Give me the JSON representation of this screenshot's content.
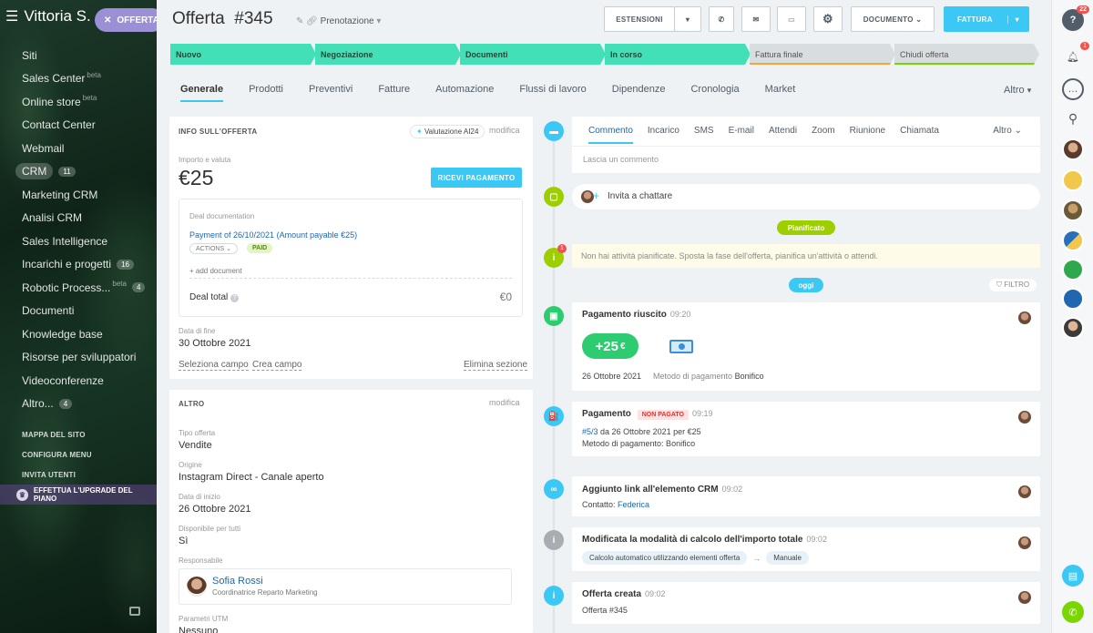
{
  "sidebar": {
    "title": "Vittoria S.",
    "pill_label": "OFFERTA",
    "items": [
      {
        "label": "Siti"
      },
      {
        "label": "Sales Center",
        "beta": "beta"
      },
      {
        "label": "Online store",
        "beta": "beta"
      },
      {
        "label": "Contact Center"
      },
      {
        "label": "Webmail"
      },
      {
        "label": "CRM",
        "count": "11",
        "active": true
      },
      {
        "label": "Marketing CRM"
      },
      {
        "label": "Analisi CRM"
      },
      {
        "label": "Sales Intelligence"
      },
      {
        "label": "Incarichi e progetti",
        "count": "16"
      },
      {
        "label": "Robotic Process...",
        "beta": "beta",
        "count": "4"
      },
      {
        "label": "Documenti"
      },
      {
        "label": "Knowledge base"
      },
      {
        "label": "Risorse per sviluppatori"
      },
      {
        "label": "Videoconferenze"
      },
      {
        "label": "Altro...",
        "count": "4"
      }
    ],
    "links": [
      "MAPPA DEL SITO",
      "CONFIGURA MENU",
      "INVITA UTENTI"
    ],
    "upgrade": "EFFETTUA L'UPGRADE DEL PIANO"
  },
  "header": {
    "title": "Offerta  #345",
    "subtitle": "Prenotazione",
    "buttons": {
      "estensioni": "ESTENSIONI",
      "documento": "DOCUMENTO",
      "fattura": "FATTURA"
    }
  },
  "stages": [
    {
      "label": "Nuovo",
      "done": true
    },
    {
      "label": "Negoziazione",
      "done": true
    },
    {
      "label": "Documenti",
      "done": true
    },
    {
      "label": "In corso",
      "done": true
    },
    {
      "label": "Fattura finale",
      "done": false
    },
    {
      "label": "Chiudi offerta",
      "done": false
    }
  ],
  "tabs": [
    "Generale",
    "Prodotti",
    "Preventivi",
    "Fatture",
    "Automazione",
    "Flussi di lavoro",
    "Dipendenze",
    "Cronologia",
    "Market"
  ],
  "tabs_more": "Altro",
  "info": {
    "header": "INFO SULL'OFFERTA",
    "ai_badge": "Valutazione AI24",
    "edit": "modifica",
    "amount_label": "Importo e valuta",
    "amount": "€25",
    "pay_button": "RICEVI PAGAMENTO",
    "doc_label": "Deal documentation",
    "payment_link": "Payment of 26/10/2021 (Amount payable €25)",
    "actions": "ACTIONS",
    "paid": "PAID",
    "add_document": "+ add document",
    "deal_total_label": "Deal total",
    "deal_total_value": "€0",
    "end_date_label": "Data di fine",
    "end_date": "30 Ottobre 2021",
    "select_field": "Seleziona campo",
    "create_field": "Crea campo",
    "delete_section": "Elimina sezione"
  },
  "altro": {
    "header": "ALTRO",
    "edit": "modifica",
    "fields": [
      {
        "label": "Tipo offerta",
        "value": "Vendite"
      },
      {
        "label": "Origine",
        "value": "Instagram Direct - Canale aperto"
      },
      {
        "label": "Data di inizio",
        "value": "26 Ottobre 2021"
      },
      {
        "label": "Disponibile per tutti",
        "value": "Sì"
      }
    ],
    "responsible_label": "Responsabile",
    "responsible_name": "Sofia Rossi",
    "responsible_role": "Coordinatrice Reparto Marketing",
    "utm_label": "Parametri UTM",
    "utm_value": "Nessuno"
  },
  "composer": {
    "tabs": [
      "Commento",
      "Incarico",
      "SMS",
      "E-mail",
      "Attendi",
      "Zoom",
      "Riunione",
      "Chiamata"
    ],
    "more": "Altro",
    "placeholder": "Lascia un commento"
  },
  "timeline": {
    "invite": "Invita a chattare",
    "planned_pill": "Pianificato",
    "notice": "Non hai attività pianificate. Sposta la fase dell'offerta, pianifica un'attività o attendi.",
    "notice_badge": "1",
    "today_pill": "oggi",
    "filter": "FILTRO",
    "payment_ok": {
      "title": "Pagamento riuscito",
      "time": "09:20",
      "amount": "+25",
      "currency": "€",
      "date": "26 Ottobre 2021",
      "method_label": "Metodo di pagamento",
      "method": "Bonifico"
    },
    "payment": {
      "title": "Pagamento",
      "badge": "NON PAGATO",
      "time": "09:19",
      "ref": "#5/3",
      "line1": "da 26 Ottobre 2021 per €25",
      "line2": "Metodo di pagamento: Bonifico"
    },
    "link": {
      "title": "Aggiunto link all'elemento CRM",
      "time": "09:02",
      "contact_label": "Contatto:",
      "contact": "Federica"
    },
    "calc": {
      "title": "Modificata la modalità di calcolo dell'importo totale",
      "time": "09:02",
      "from": "Calcolo automatico utilizzando elementi offerta",
      "arrow": "→",
      "to": "Manuale"
    },
    "created": {
      "title": "Offerta creata",
      "time": "09:02",
      "text": "Offerta #345"
    }
  },
  "rail": {
    "help_badge": "22",
    "bell_badge": "1"
  },
  "colors": {
    "accent": "#3bc8f5",
    "stage_done": "#43e0b7",
    "green": "#9dcf00",
    "success": "#2ecc71",
    "danger": "#f0524f"
  }
}
